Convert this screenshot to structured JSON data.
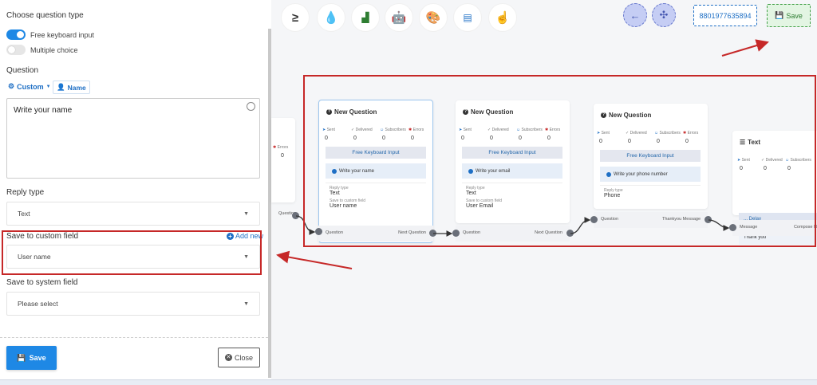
{
  "panel": {
    "question_type_title": "Choose question type",
    "options": [
      {
        "label": "Free keyboard input",
        "on": true
      },
      {
        "label": "Multiple choice",
        "on": false
      }
    ],
    "question_title": "Question",
    "custom_label": "Custom",
    "name_label": "Name",
    "question_text": "Write your name",
    "reply_type_title": "Reply type",
    "reply_type_value": "Text",
    "custom_field_title": "Save to custom field",
    "add_new_label": "Add new",
    "custom_field_value": "User name",
    "system_field_title": "Save to system field",
    "system_field_placeholder": "Please select",
    "save_label": "Save",
    "close_label": "Close"
  },
  "toolbar": {
    "phone": "8801977635894",
    "save_label": "Save",
    "tools": [
      "≥",
      "drop-icon",
      "chart-icon",
      "robot-icon",
      "palette-icon",
      "excel-icon",
      "hand-icon"
    ]
  },
  "stat_labels": [
    "Sent",
    "Delivered",
    "Subscribers",
    "Errors"
  ],
  "partial_card": {
    "stat_label": "Errors",
    "value": "0",
    "port_right": "Question"
  },
  "cards": [
    {
      "title": "New Question",
      "stats": [
        "0",
        "0",
        "0",
        "0"
      ],
      "button": "Free Keyboard Input",
      "prompt": "Write your name",
      "reply_type_label": "Reply type",
      "reply_type": "Text",
      "custom_label": "Save to custom field",
      "custom": "User name",
      "port_left": "Question",
      "port_right": "Next Question"
    },
    {
      "title": "New Question",
      "stats": [
        "0",
        "0",
        "0",
        "0"
      ],
      "button": "Free Keyboard Input",
      "prompt": "Write your email",
      "reply_type_label": "Reply type",
      "reply_type": "Text",
      "custom_label": "Save to custom field",
      "custom": "User Email",
      "port_left": "Question",
      "port_right": "Next Question"
    },
    {
      "title": "New Question",
      "stats": [
        "0",
        "0",
        "0",
        "0"
      ],
      "button": "Free Keyboard Input",
      "prompt": "Write your phone number",
      "reply_type_label": "Reply type",
      "reply_type": "Phone",
      "port_left": "Question",
      "port_right": "Thankyou Message"
    }
  ],
  "text_card": {
    "title": "Text",
    "stats": [
      "0",
      "0",
      "0"
    ],
    "stat_labels": [
      "Sent",
      "Delivered",
      "Subscribers"
    ],
    "delay": "... Delay",
    "message": "Thank you",
    "port_left": "Message",
    "port_right": "Compose N"
  }
}
